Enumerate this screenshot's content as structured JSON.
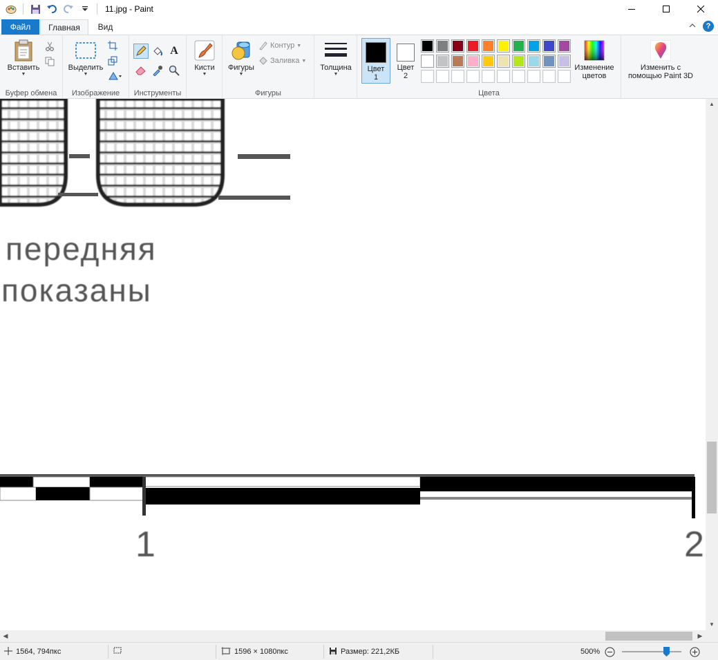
{
  "window": {
    "title": "11.jpg - Paint",
    "minimize": "—",
    "maximize": "☐",
    "close": "✕"
  },
  "tabs": {
    "file": "Файл",
    "home": "Главная",
    "view": "Вид"
  },
  "ribbon": {
    "clipboard": {
      "label": "Буфер обмена",
      "paste": "Вставить"
    },
    "image": {
      "label": "Изображение",
      "select": "Выделить"
    },
    "tools": {
      "label": "Инструменты",
      "text_glyph": "A"
    },
    "brushes": {
      "label": "Кисти"
    },
    "shapes": {
      "label": "Фигуры",
      "shapes_btn": "Фигуры",
      "outline": "Контур",
      "fill": "Заливка"
    },
    "size": {
      "label": "Толщина"
    },
    "colors": {
      "label": "Цвета",
      "color1_a": "Цвет",
      "color1_b": "1",
      "color2_a": "Цвет",
      "color2_b": "2",
      "edit": "Изменение цветов",
      "color1_value": "#000000",
      "color2_value": "#ffffff",
      "palette_row1": [
        "#000000",
        "#7f7f7f",
        "#880015",
        "#ed1c24",
        "#ff7f27",
        "#fff200",
        "#22b14c",
        "#00a2e8",
        "#3f48cc",
        "#a349a4"
      ],
      "palette_row2": [
        "#ffffff",
        "#c3c3c3",
        "#b97a57",
        "#ffaec9",
        "#ffc90e",
        "#efe4b0",
        "#b5e61d",
        "#99d9ea",
        "#7092be",
        "#c8bfe7"
      ],
      "palette_row3": [
        "#ffffff",
        "#ffffff",
        "#ffffff",
        "#ffffff",
        "#ffffff",
        "#ffffff",
        "#ffffff",
        "#ffffff",
        "#ffffff",
        "#ffffff"
      ]
    },
    "paint3d": {
      "label": "Изменить с помощью Paint 3D"
    }
  },
  "canvas": {
    "text_line1": "передняя",
    "text_line2": "показаны",
    "number_1": "1",
    "number_2": "2"
  },
  "status": {
    "cursor_pos": "1564, 794пкс",
    "image_size": "1596 × 1080пкс",
    "file_size": "Размер: 221,2КБ",
    "zoom": "500%"
  }
}
